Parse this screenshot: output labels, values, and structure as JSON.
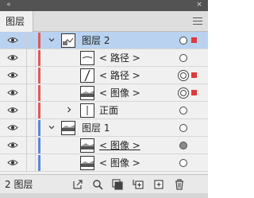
{
  "panel": {
    "tab_label": "图层",
    "footer": {
      "layer_count": "2 图层"
    }
  },
  "colors": {
    "layer1_color": "#dd5a5a",
    "layer2_color": "#5b87d6",
    "selection_fill": "#b8d2f0",
    "selected_square": "#e03a3a"
  },
  "rows": [
    {
      "label": "图层 2",
      "kind": "layer",
      "expanded": true,
      "selected": true,
      "target": "hollow",
      "selection_square": true
    },
    {
      "label": "< 路径 >",
      "kind": "path",
      "target": "hollow",
      "selection_square": false
    },
    {
      "label": "< 路径 >",
      "kind": "path",
      "target": "double",
      "selection_square": true
    },
    {
      "label": "< 图像 >",
      "kind": "image",
      "target": "double",
      "selection_square": true
    },
    {
      "label": "正面",
      "kind": "group",
      "expanded": false,
      "target": "hollow",
      "selection_square": false
    },
    {
      "label": "图层 1",
      "kind": "layer",
      "expanded": true,
      "selected": false,
      "target": "hollow",
      "selection_square": false
    },
    {
      "label": "< 图像 >",
      "kind": "image",
      "target": "filled",
      "selection_square": false
    },
    {
      "label": "< 图像 >",
      "kind": "image",
      "target": "hollow",
      "selection_square": false
    }
  ],
  "bottom_icons": [
    "export-icon",
    "search-icon",
    "clipping-mask-icon",
    "new-sublayer-icon",
    "new-layer-icon",
    "delete-icon"
  ]
}
